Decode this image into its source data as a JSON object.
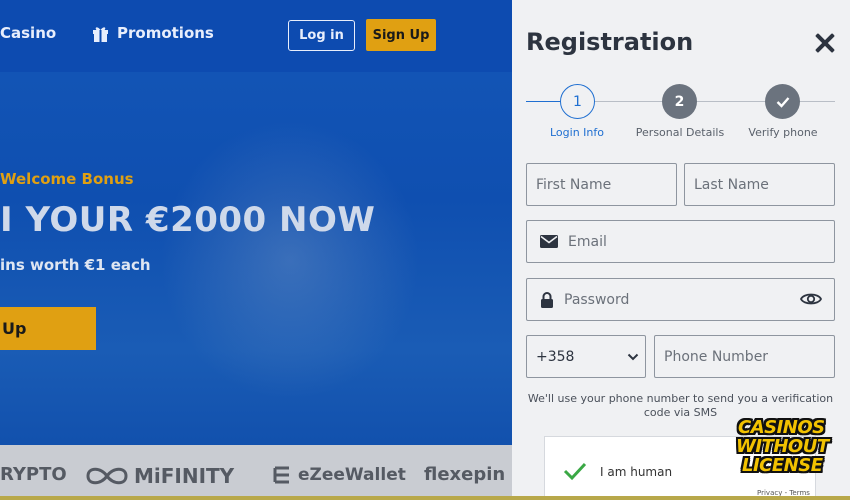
{
  "nav": {
    "casino_label": "Casino",
    "promotions_label": "Promotions",
    "login_label": "Log in",
    "signup_label": "Sign Up"
  },
  "hero": {
    "bonus_label": "Welcome Bonus",
    "title": "I YOUR €2000 NOW",
    "subtitle": "ins worth €1 each",
    "cta_label": "Up"
  },
  "payments": [
    "RYPTO",
    "MiFINITY",
    "eZeeWallet",
    "flexepin"
  ],
  "registration": {
    "title": "Registration",
    "steps": [
      {
        "number": "1",
        "label": "Login Info",
        "state": "active"
      },
      {
        "number": "2",
        "label": "Personal Details",
        "state": "pending"
      },
      {
        "number": "✓",
        "label": "Verify phone",
        "state": "pending"
      }
    ],
    "first_name_placeholder": "First Name",
    "last_name_placeholder": "Last Name",
    "email_placeholder": "Email",
    "password_placeholder": "Password",
    "country_code": "+358",
    "phone_placeholder": "Phone Number",
    "hint": "We'll use your phone number to send you a verification code via SMS",
    "captcha_label": "I am human",
    "captcha_links": "Privacy - Terms"
  },
  "watermark": {
    "line1": "CASINOS",
    "line2": "WITHOUT",
    "line3": "LICENSE"
  },
  "colors": {
    "accent": "#e0a012",
    "brand_blue": "#0d4bb0",
    "step_active": "#1f6fd1",
    "badge_yellow": "#f2c200"
  }
}
